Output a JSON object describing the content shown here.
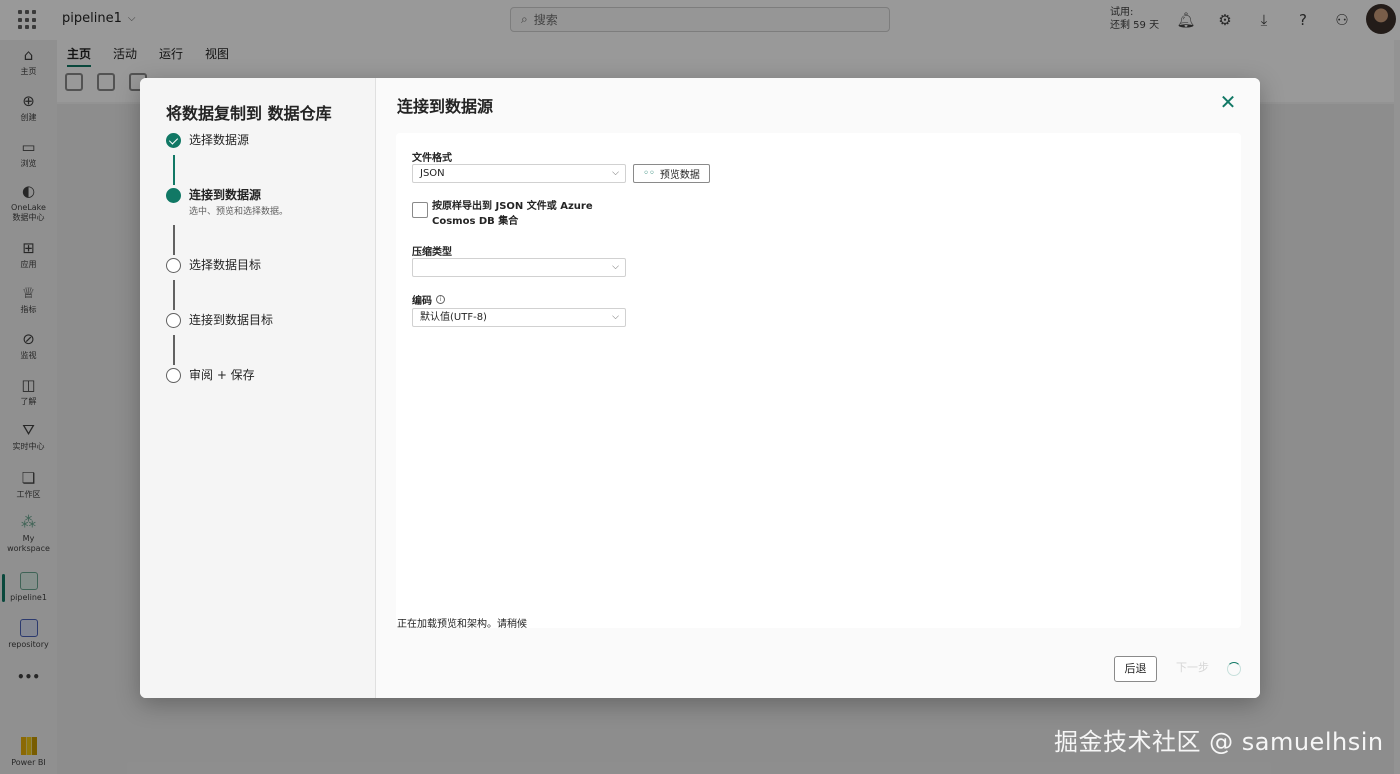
{
  "app": {
    "pipeline_name": "pipeline1",
    "search_placeholder": "搜索",
    "trial_line1": "试用:",
    "trial_line2": "还剩 59 天"
  },
  "ribbon": {
    "tabs": [
      "主页",
      "活动",
      "运行",
      "视图"
    ]
  },
  "rail": {
    "items": [
      {
        "label": "主页",
        "icon": "home-icon"
      },
      {
        "label": "创建",
        "icon": "plus-circle-icon"
      },
      {
        "label": "浏览",
        "icon": "folder-icon"
      },
      {
        "label": "OneLake 数据中心",
        "icon": "onelake-icon"
      },
      {
        "label": "应用",
        "icon": "apps-icon"
      },
      {
        "label": "指标",
        "icon": "trophy-icon"
      },
      {
        "label": "监视",
        "icon": "monitor-icon"
      },
      {
        "label": "了解",
        "icon": "book-icon"
      },
      {
        "label": "实时中心",
        "icon": "realtime-icon"
      },
      {
        "label": "工作区",
        "icon": "workspaces-icon"
      },
      {
        "label": "My workspace",
        "icon": "my-workspace-icon"
      },
      {
        "label": "pipeline1",
        "icon": "pipeline-icon"
      },
      {
        "label": "repository",
        "icon": "repository-icon"
      },
      {
        "label": "Power BI",
        "icon": "power-bi-icon"
      }
    ],
    "more": "•••"
  },
  "dialog": {
    "wizard_title": "将数据复制到 数据仓库",
    "steps": [
      {
        "label": "选择数据源",
        "status": "done"
      },
      {
        "label": "连接到数据源",
        "status": "current",
        "sub": "选中、预览和选择数据。"
      },
      {
        "label": "选择数据目标",
        "status": "todo"
      },
      {
        "label": "连接到数据目标",
        "status": "todo"
      },
      {
        "label": "审阅 + 保存",
        "status": "todo"
      }
    ],
    "title": "连接到数据源",
    "file_format_label": "文件格式",
    "file_format_value": "JSON",
    "preview_button": "预览数据",
    "export_checkbox_label": "按原样导出到 JSON 文件或 Azure Cosmos DB 集合",
    "compression_label": "压缩类型",
    "compression_value": "",
    "encoding_label": "编码",
    "encoding_value": "默认值(UTF-8)",
    "loading_text": "正在加载预览和架构。请稍候",
    "back_button": "后退",
    "next_button": "下一步"
  },
  "watermark": "掘金技术社区 @ samuelhsin",
  "colors": {
    "accent": "#117865"
  }
}
